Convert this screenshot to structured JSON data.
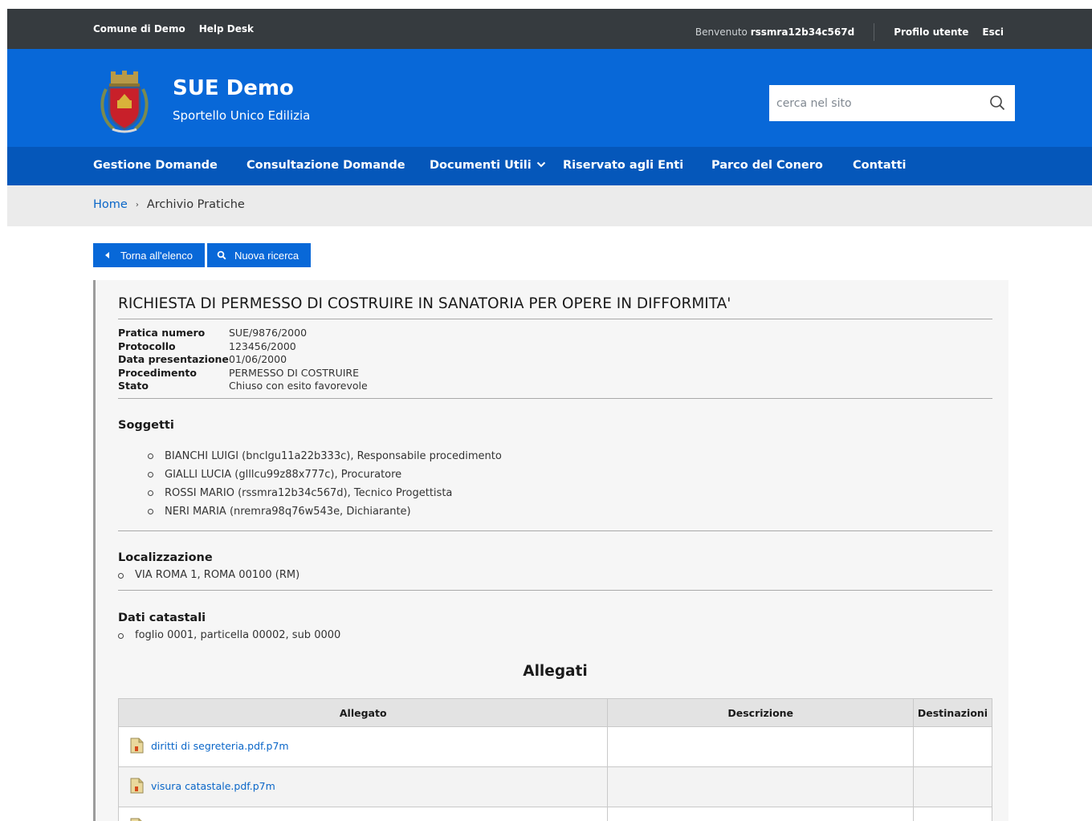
{
  "topbar": {
    "links": [
      "Comune di Demo",
      "Help Desk"
    ],
    "welcome_prefix": "Benvenuto",
    "username": "rssmra12b34c567d",
    "profile_label": "Profilo utente",
    "logout_label": "Esci"
  },
  "header": {
    "title": "SUE Demo",
    "subtitle": "Sportello Unico Edilizia",
    "search_placeholder": "cerca nel sito",
    "brand_color": "#0868d8",
    "nav_color": "#0557ba"
  },
  "nav": {
    "items": [
      "Gestione Domande",
      "Consultazione Domande",
      "Documenti Utili",
      "Riservato agli Enti",
      "Parco del Conero",
      "Contatti"
    ]
  },
  "breadcrumb": {
    "home": "Home",
    "current": "Archivio Pratiche"
  },
  "actions": {
    "back_label": "Torna all'elenco",
    "search_label": "Nuova ricerca"
  },
  "practice": {
    "title": "RICHIESTA DI PERMESSO DI COSTRUIRE IN SANATORIA PER OPERE IN DIFFORMITA'",
    "fields": [
      {
        "key": "Pratica numero",
        "value": "SUE/9876/2000"
      },
      {
        "key": "Protocollo",
        "value": "123456/2000"
      },
      {
        "key": "Data presentazione",
        "value": "01/06/2000"
      },
      {
        "key": "Procedimento",
        "value": "PERMESSO DI COSTRUIRE"
      },
      {
        "key": "Stato",
        "value": "Chiuso con esito favorevole"
      }
    ]
  },
  "subjects": {
    "heading": "Soggetti",
    "items": [
      "BIANCHI LUIGI (bnclgu11a22b333c), Responsabile procedimento",
      "GIALLI LUCIA (glllcu99z88x777c), Procuratore",
      "ROSSI MARIO (rssmra12b34c567d), Tecnico Progettista",
      "NERI MARIA (nremra98q76w543e, Dichiarante)"
    ]
  },
  "location": {
    "heading": "Localizzazione",
    "items": [
      "VIA ROMA 1, ROMA 00100 (RM)"
    ]
  },
  "cadastre": {
    "heading": "Dati catastali",
    "items": [
      "foglio 0001, particella 00002, sub 0000"
    ]
  },
  "attachments": {
    "heading": "Allegati",
    "columns": [
      "Allegato",
      "Descrizione",
      "Destinazioni"
    ],
    "rows": [
      {
        "file": "diritti di segreteria.pdf.p7m",
        "description": "",
        "destinations": ""
      },
      {
        "file": "visura catastale.pdf.p7m",
        "description": "",
        "destinations": ""
      },
      {
        "file": "",
        "description": "",
        "destinations": ""
      }
    ]
  }
}
